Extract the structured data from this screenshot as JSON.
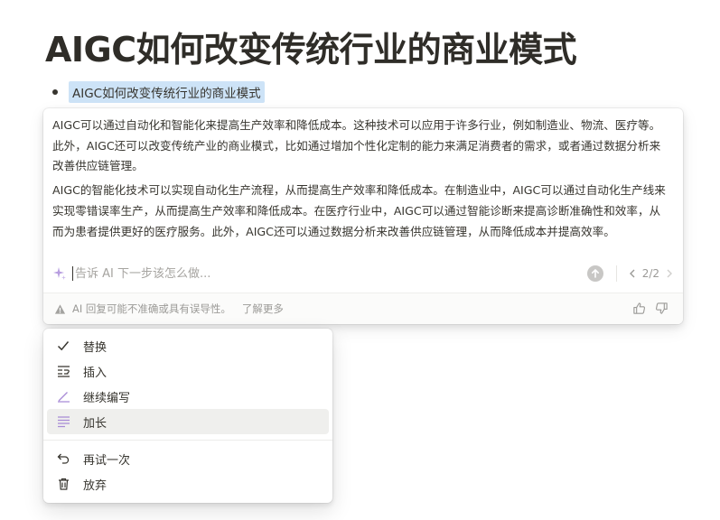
{
  "page": {
    "title": "AIGC如何改变传统行业的商业模式"
  },
  "bullet": {
    "text": "AIGC如何改变传统行业的商业模式"
  },
  "ai_response": {
    "paragraphs": [
      "AIGC可以通过自动化和智能化来提高生产效率和降低成本。这种技术可以应用于许多行业，例如制造业、物流、医疗等。此外，AIGC还可以改变传统产业的商业模式，比如通过增加个性化定制的能力来满足消费者的需求，或者通过数据分析来改善供应链管理。",
      "AIGC的智能化技术可以实现自动化生产流程，从而提高生产效率和降低成本。在制造业中，AIGC可以通过自动化生产线来实现零错误率生产，从而提高生产效率和降低成本。在医疗行业中，AIGC可以通过智能诊断来提高诊断准确性和效率，从而为患者提供更好的医疗服务。此外，AIGC还可以通过数据分析来改善供应链管理，从而降低成本并提高效率。"
    ]
  },
  "ask": {
    "placeholder": "告诉 AI 下一步该怎么做...",
    "value": "",
    "pager": "2/2"
  },
  "footer": {
    "disclaimer": "AI 回复可能不准确或具有误导性。",
    "learn_more": "了解更多"
  },
  "menu": {
    "items": [
      {
        "label": "替换",
        "icon": "check-icon"
      },
      {
        "label": "插入",
        "icon": "insert-below-icon"
      },
      {
        "label": "继续编写",
        "icon": "pen-icon"
      },
      {
        "label": "加长",
        "icon": "lines-icon",
        "active": true
      },
      {
        "label": "再试一次",
        "icon": "undo-icon"
      },
      {
        "label": "放弃",
        "icon": "trash-icon"
      }
    ]
  },
  "colors": {
    "highlight": "#cde3f7",
    "accent_purple": "#a88ad6",
    "text": "#37352f",
    "muted": "#9b9a97"
  }
}
